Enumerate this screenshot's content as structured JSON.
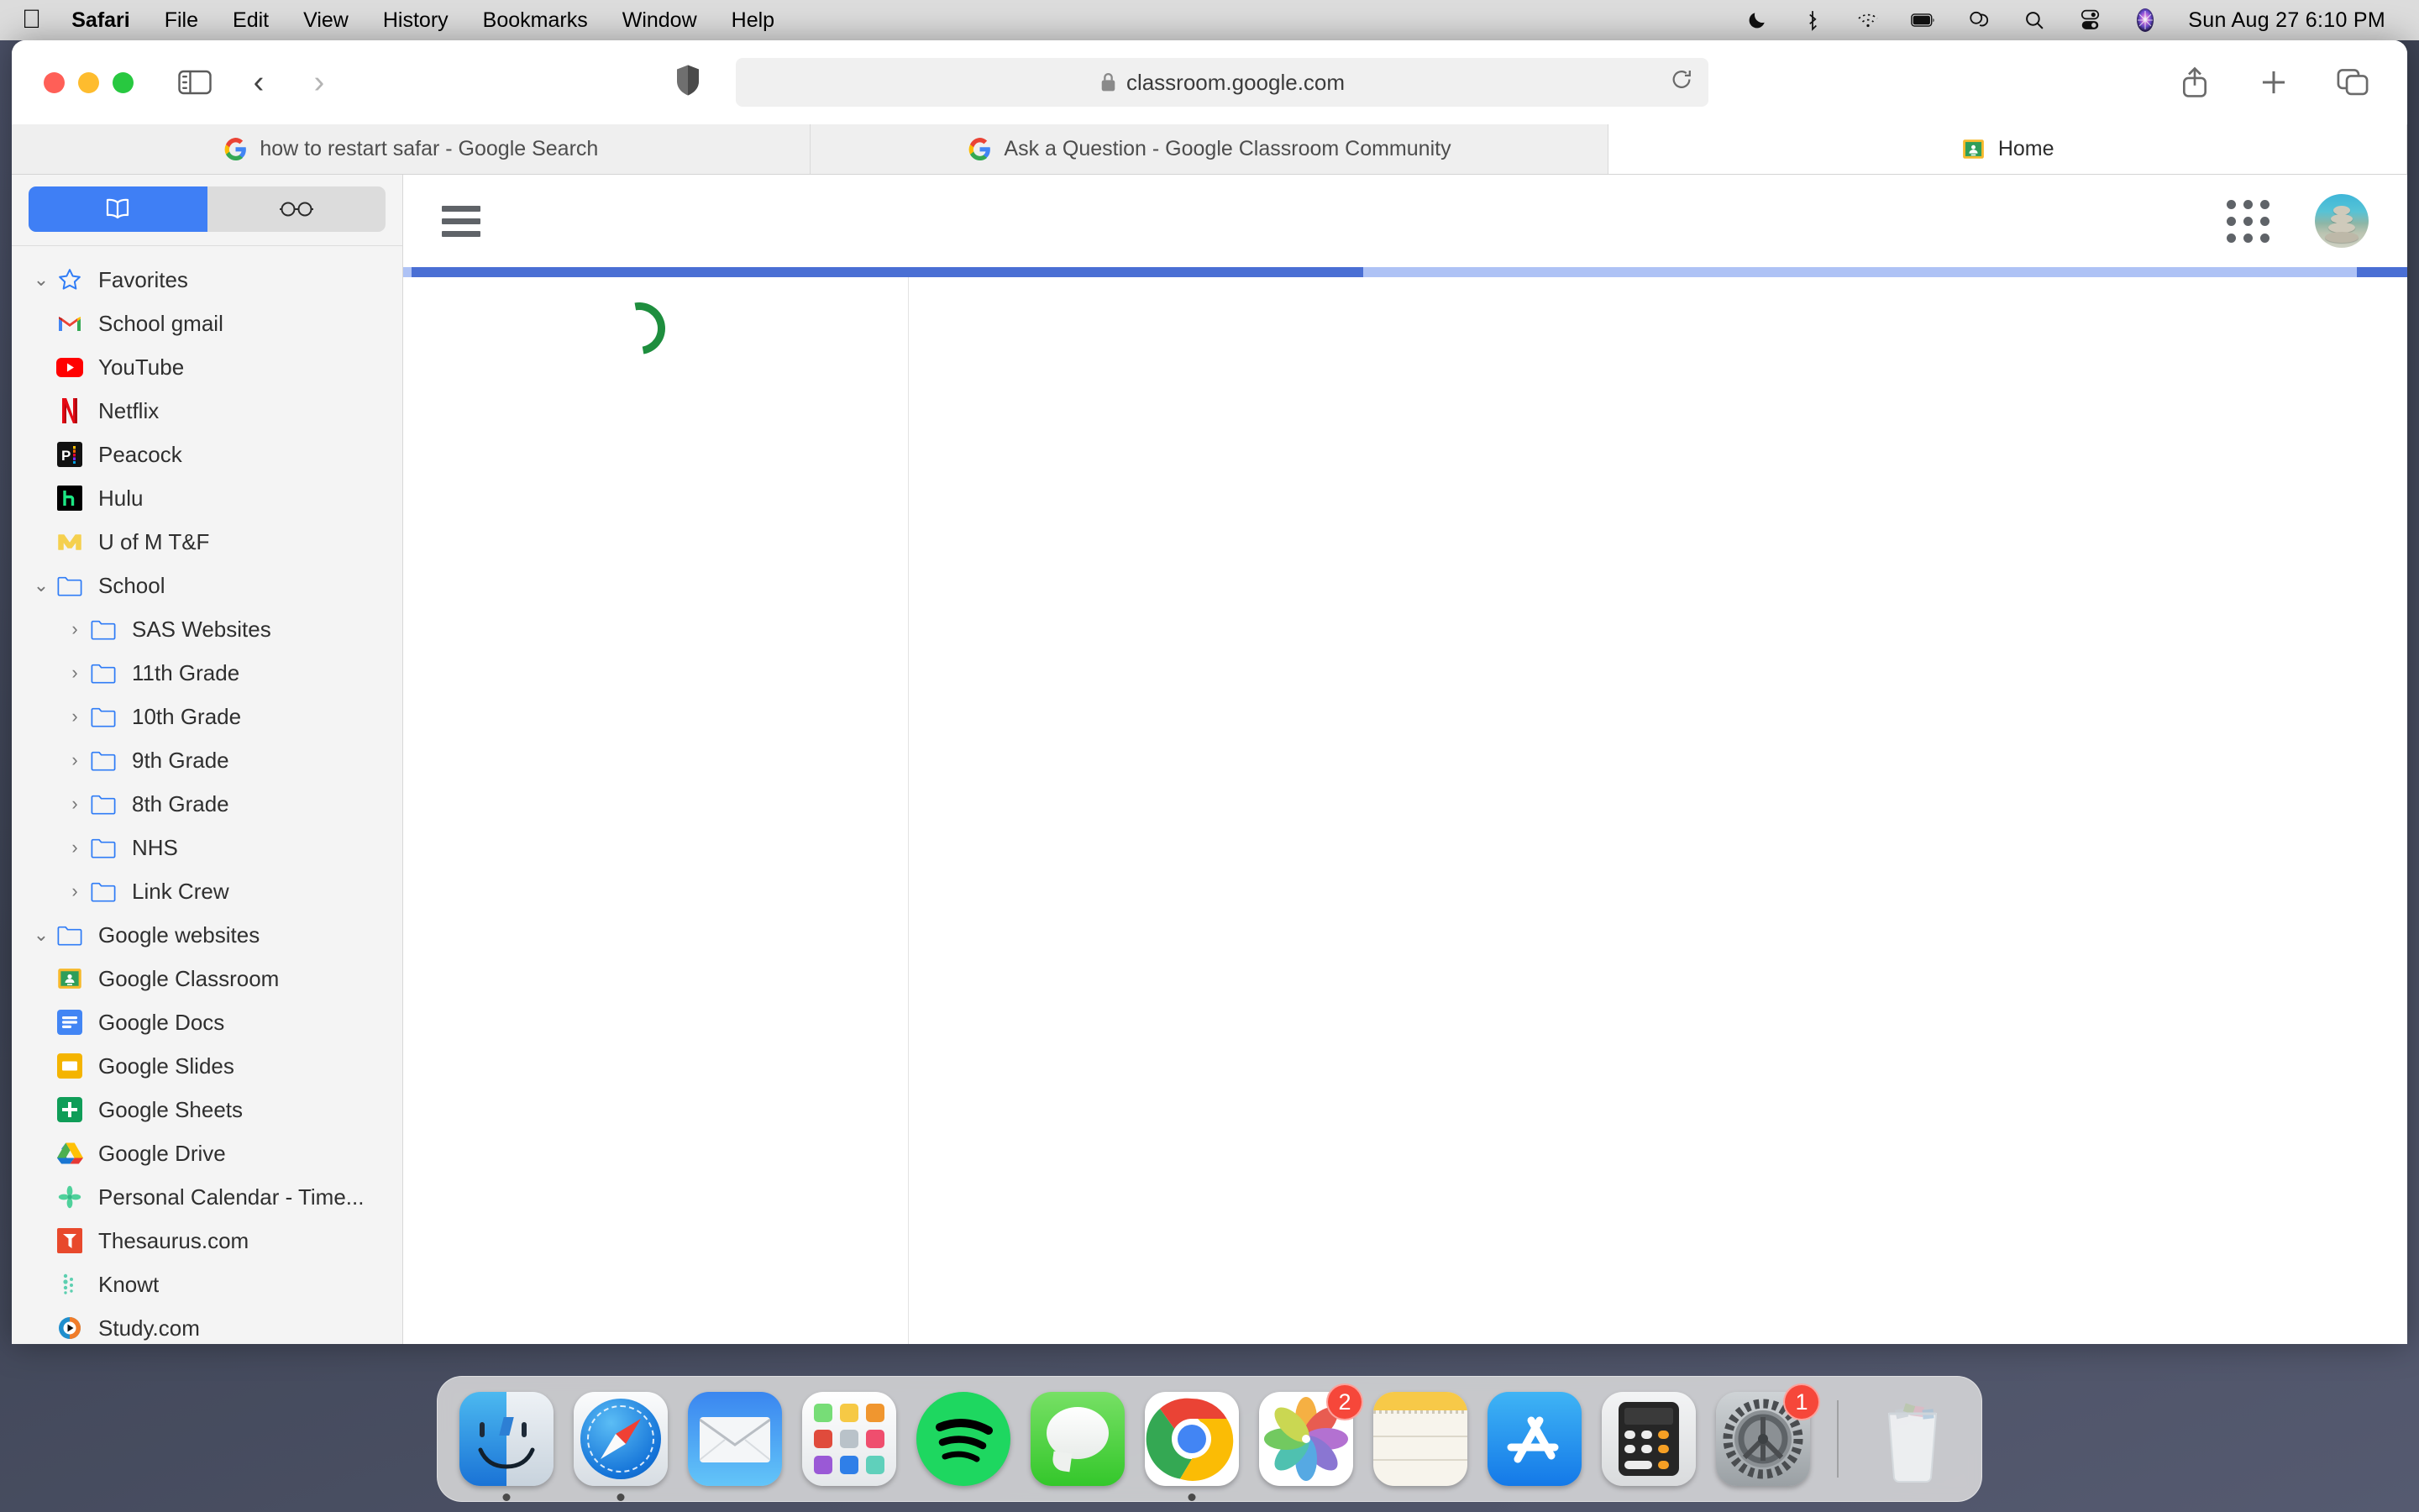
{
  "menubar": {
    "apple_icon": "apple-logo",
    "items": [
      "Safari",
      "File",
      "Edit",
      "View",
      "History",
      "Bookmarks",
      "Window",
      "Help"
    ],
    "status_icons": [
      "moon-icon",
      "bluetooth-icon",
      "wifi-icon",
      "battery-icon",
      "screen-mirroring-icon",
      "search-icon",
      "control-center-icon",
      "siri-icon"
    ],
    "clock": "Sun Aug 27  6:10 PM"
  },
  "toolbar": {
    "window_controls": [
      "close-button",
      "minimize-button",
      "zoom-button"
    ],
    "sidebar_toggle": "sidebar-icon",
    "back": "‹",
    "forward": "›",
    "privacy_icon": "shield-icon",
    "url": "classroom.google.com",
    "lock_icon": "lock-icon",
    "reload_icon": "reload-icon",
    "share_icon": "share-icon",
    "new_tab_icon": "plus-icon",
    "tab_overview_icon": "tab-overview-icon"
  },
  "tabs": [
    {
      "label": "how to restart safar - Google Search",
      "favicon": "google-g-icon",
      "active": false
    },
    {
      "label": "Ask a Question - Google Classroom Community",
      "favicon": "google-g-icon",
      "active": false
    },
    {
      "label": "Home",
      "favicon": "google-classroom-icon",
      "active": true
    }
  ],
  "sidebar": {
    "segmented": [
      {
        "icon": "bookmarks-book-icon",
        "selected": true
      },
      {
        "icon": "reading-list-glasses-icon",
        "selected": false
      }
    ],
    "groups": [
      {
        "title": "Favorites",
        "icon": "star-icon",
        "twisty": "⌄",
        "expanded": true,
        "items": [
          {
            "label": "School gmail",
            "icon": "gmail-icon"
          },
          {
            "label": "YouTube",
            "icon": "youtube-icon"
          },
          {
            "label": "Netflix",
            "icon": "netflix-icon"
          },
          {
            "label": "Peacock",
            "icon": "peacock-icon"
          },
          {
            "label": "Hulu",
            "icon": "hulu-icon"
          },
          {
            "label": "U of M T&F",
            "icon": "michigan-icon"
          }
        ]
      },
      {
        "title": "School",
        "icon": "folder-icon",
        "twisty": "⌄",
        "expanded": true,
        "items": [
          {
            "label": "SAS Websites",
            "icon": "folder-icon",
            "twisty": "›"
          },
          {
            "label": "11th Grade",
            "icon": "folder-icon",
            "twisty": "›"
          },
          {
            "label": "10th Grade",
            "icon": "folder-icon",
            "twisty": "›"
          },
          {
            "label": "9th Grade",
            "icon": "folder-icon",
            "twisty": "›"
          },
          {
            "label": "8th Grade",
            "icon": "folder-icon",
            "twisty": "›"
          },
          {
            "label": "NHS",
            "icon": "folder-icon",
            "twisty": "›"
          },
          {
            "label": "Link Crew",
            "icon": "folder-icon",
            "twisty": "›"
          }
        ]
      },
      {
        "title": "Google websites",
        "icon": "folder-icon",
        "twisty": "⌄",
        "expanded": true,
        "items": [
          {
            "label": "Google Classroom",
            "icon": "google-classroom-icon"
          },
          {
            "label": "Google Docs",
            "icon": "google-docs-icon"
          },
          {
            "label": "Google Slides",
            "icon": "google-slides-icon"
          },
          {
            "label": "Google Sheets",
            "icon": "google-sheets-icon"
          },
          {
            "label": "Google Drive",
            "icon": "google-drive-icon"
          },
          {
            "label": "Personal Calendar - Time...",
            "icon": "calendar-leaf-icon"
          },
          {
            "label": "Thesaurus.com",
            "icon": "thesaurus-icon"
          },
          {
            "label": "Knowt",
            "icon": "knowt-icon"
          },
          {
            "label": "Study.com",
            "icon": "study-icon"
          }
        ]
      }
    ]
  },
  "page": {
    "menu_icon": "hamburger-menu-icon",
    "apps_icon": "google-apps-grid-icon",
    "account_avatar": "account-avatar",
    "loading_spinner": "loading-spinner",
    "progress": {
      "visible": true,
      "percent": 48
    },
    "accent_color": "#4a6fd4",
    "spinner_color": "#1e8e3e"
  },
  "dock": {
    "items": [
      {
        "name": "finder",
        "running": true,
        "badge": null
      },
      {
        "name": "safari",
        "running": true,
        "badge": null
      },
      {
        "name": "mail",
        "running": false,
        "badge": null
      },
      {
        "name": "launchpad",
        "running": false,
        "badge": null
      },
      {
        "name": "spotify",
        "running": false,
        "badge": null
      },
      {
        "name": "messages",
        "running": false,
        "badge": null
      },
      {
        "name": "chrome",
        "running": true,
        "badge": null
      },
      {
        "name": "photos",
        "running": false,
        "badge": "2"
      },
      {
        "name": "notes",
        "running": false,
        "badge": null
      },
      {
        "name": "app-store",
        "running": false,
        "badge": null
      },
      {
        "name": "calculator",
        "running": false,
        "badge": null
      },
      {
        "name": "system-settings",
        "running": false,
        "badge": "1"
      }
    ],
    "trash": {
      "name": "trash",
      "label": "Trash"
    }
  }
}
